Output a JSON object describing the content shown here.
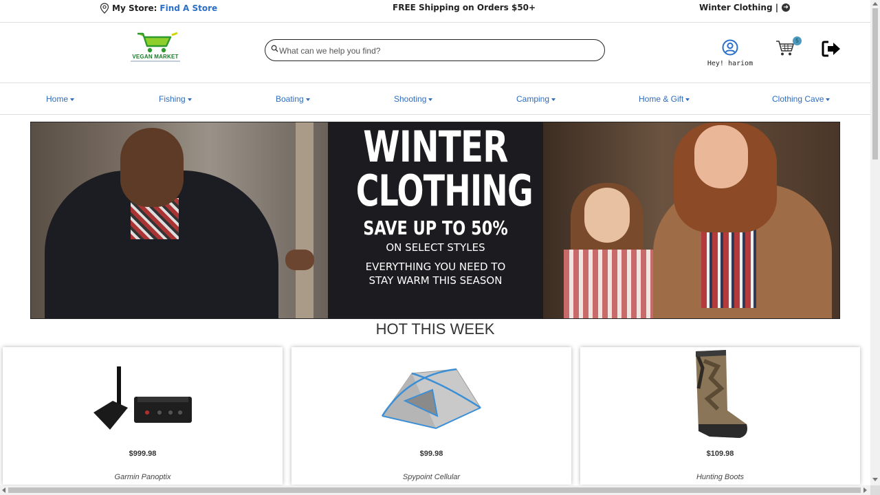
{
  "topbar": {
    "store_label": "My Store:",
    "store_link": "Find A Store",
    "shipping": "FREE Shipping on Orders $50+",
    "promo": "Winter Clothing |"
  },
  "header": {
    "logo_text": "VEGAN MARKET",
    "search_placeholder": "What can we help you find?",
    "user_greeting": "Hey! hariom",
    "cart_count": "5"
  },
  "nav": {
    "items": [
      "Home",
      "Fishing",
      "Boating",
      "Shooting",
      "Camping",
      "Home & Gift",
      "Clothing Cave"
    ]
  },
  "banner": {
    "title_line1": "WINTER",
    "title_line2": "CLOTHING",
    "save": "SAVE UP TO 50%",
    "select": "ON SELECT STYLES",
    "every_line1": "EVERYTHING YOU NEED TO",
    "every_line2": "STAY WARM THIS SEASON"
  },
  "hot": {
    "title": "HOT THIS WEEK",
    "products": [
      {
        "price": "$999.98",
        "name": "Garmin Panoptix"
      },
      {
        "price": "$99.98",
        "name": "Spypoint Cellular"
      },
      {
        "price": "$109.98",
        "name": "Hunting Boots"
      }
    ]
  },
  "colors": {
    "link": "#2d6cbf",
    "banner_bg": "#1c1b1f",
    "cart_badge": "#4a9bbd"
  }
}
